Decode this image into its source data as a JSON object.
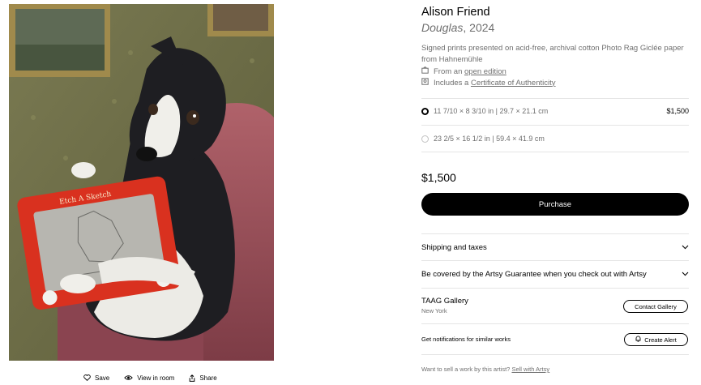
{
  "artist": {
    "name": "Alison Friend"
  },
  "artwork": {
    "title": "Douglas",
    "year_suffix": ", 2024",
    "description": "Signed prints presented on acid-free, archival cotton Photo Rag Giclée paper from Hahnemühle",
    "edition_prefix": "From an ",
    "edition_link": "open edition",
    "coa_prefix": "Includes a ",
    "coa_link": "Certificate of Authenticity"
  },
  "actions": {
    "save": "Save",
    "view_in_room": "View in room",
    "share": "Share"
  },
  "sizes": [
    {
      "label": "11 7/10 × 8 3/10 in | 29.7 × 21.1 cm",
      "price": "$1,500",
      "selected": true
    },
    {
      "label": "23 2/5 × 16 1/2 in | 59.4 × 41.9 cm",
      "price": "",
      "selected": false
    }
  ],
  "price": "$1,500",
  "purchase_label": "Purchase",
  "accordions": {
    "shipping": "Shipping and taxes",
    "guarantee": "Be covered by the Artsy Guarantee when you check out with Artsy"
  },
  "gallery": {
    "name": "TAAG Gallery",
    "location": "New York",
    "contact_label": "Contact Gallery"
  },
  "alert": {
    "text": "Get notifications for similar works",
    "button": "Create Alert"
  },
  "sell": {
    "prefix": "Want to sell a work by this artist? ",
    "link": "Sell with Artsy"
  },
  "icons": {
    "save": "heart-icon",
    "view_in_room": "eye-icon",
    "share": "share-icon",
    "edition": "frame-icon",
    "certificate": "certificate-icon",
    "chevron": "chevron-down-icon",
    "bell": "bell-icon"
  },
  "colors": {
    "accent": "#000000",
    "muted_text": "#6f6f6f",
    "divider": "#e5e5e5",
    "toy_red": "#d9311f"
  }
}
